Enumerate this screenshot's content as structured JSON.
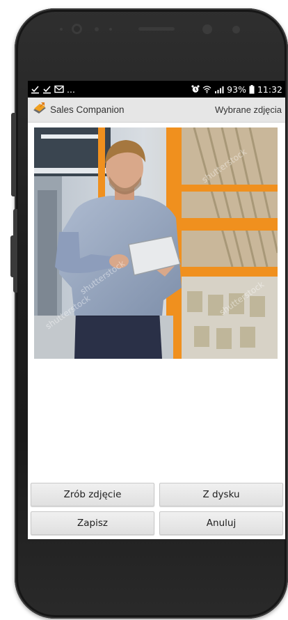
{
  "status_bar": {
    "more": "...",
    "battery": "93%",
    "time": "11:32"
  },
  "action_bar": {
    "app_title": "Sales Companion",
    "screen_title": "Wybrane zdjęcia"
  },
  "photo": {
    "watermark": "shutterstock"
  },
  "buttons": {
    "take_photo": "Zrób zdjęcie",
    "from_disk": "Z dysku",
    "save": "Zapisz",
    "cancel": "Anuluj"
  },
  "colors": {
    "status_bar_bg": "#000000",
    "action_bar_bg": "#e6e6e6",
    "button_bg": "#e4e4e4",
    "brand_orange": "#f0a020",
    "shelf_orange": "#f0901e"
  }
}
